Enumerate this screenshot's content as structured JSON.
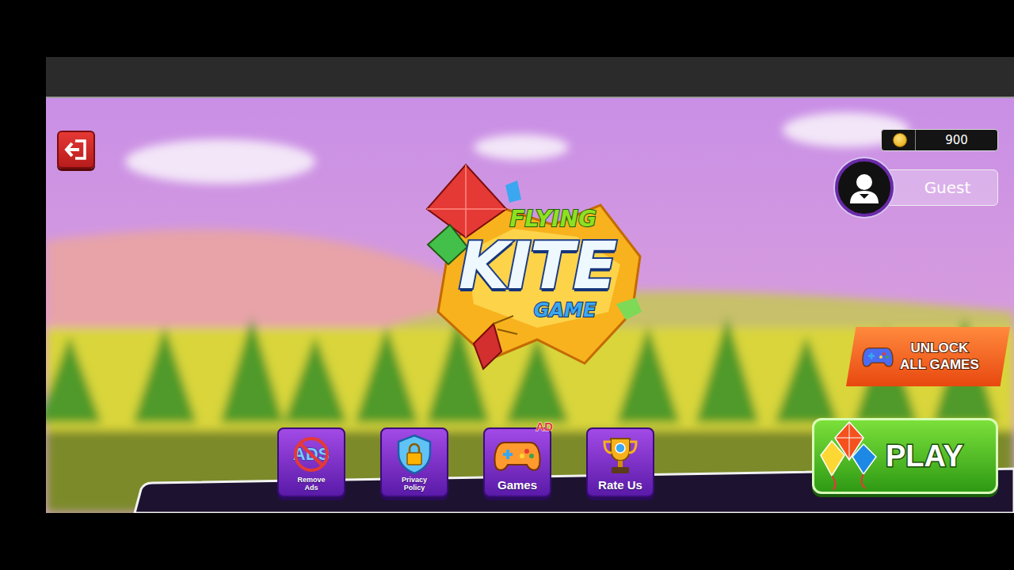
{
  "logo": {
    "top": "FLYING",
    "main": "KITE",
    "bottom": "GAME"
  },
  "coins": "900",
  "profile": {
    "name": "Guest"
  },
  "unlock_button": {
    "lines": [
      "UNLOCK",
      "ALL GAMES"
    ]
  },
  "play_button": "PLAY",
  "menu": [
    {
      "label": "Remove Ads",
      "kind": "remove-ads",
      "icon_text": "ADS",
      "badge": ""
    },
    {
      "label": "Privacy Policy",
      "kind": "privacy",
      "icon_text": "",
      "badge": ""
    },
    {
      "label": "Games",
      "kind": "games",
      "icon_text": "",
      "badge": "AD"
    },
    {
      "label": "Rate Us",
      "kind": "rate",
      "icon_text": "",
      "badge": ""
    }
  ]
}
